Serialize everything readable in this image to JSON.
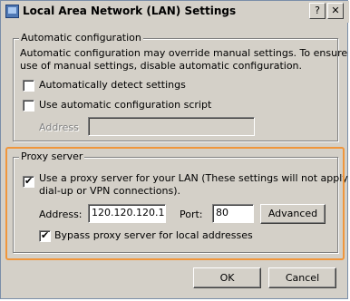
{
  "window": {
    "title": "Local Area Network (LAN) Settings",
    "help_label": "?",
    "close_label": "✕"
  },
  "auto_config": {
    "group_label": "Automatic configuration",
    "description_line1": "Automatic configuration may override manual settings.  To ensure the",
    "description_line2": "use of manual settings, disable automatic configuration.",
    "detect_label": "Automatically detect settings",
    "detect_checked": false,
    "script_label": "Use automatic configuration script",
    "script_checked": false,
    "address_label": "Address",
    "address_value": ""
  },
  "proxy": {
    "group_label": "Proxy server",
    "use_proxy_line1": "Use a proxy server for your LAN (These settings will not apply to",
    "use_proxy_line2": "dial-up or VPN connections).",
    "use_proxy_checked": true,
    "address_label": "Address:",
    "address_value": "120.120.120.1",
    "port_label": "Port:",
    "port_value": "80",
    "advanced_label": "Advanced",
    "bypass_label": "Bypass proxy server for local addresses",
    "bypass_checked": true
  },
  "footer": {
    "ok_label": "OK",
    "cancel_label": "Cancel"
  },
  "colors": {
    "highlight": "#f0963c",
    "face": "#d4d0c8"
  }
}
